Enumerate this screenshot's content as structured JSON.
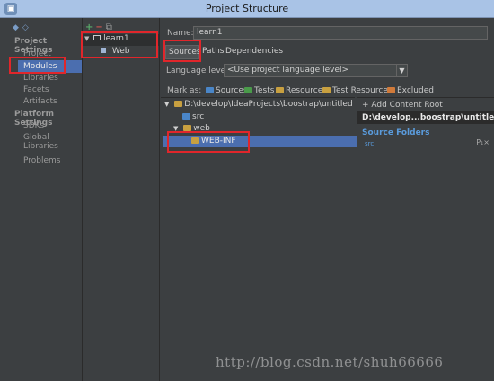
{
  "window": {
    "title": "Project Structure"
  },
  "nav": {
    "back": "◆",
    "forward": "◇",
    "project_settings_header": "Project Settings",
    "project_settings_items": [
      "Project",
      "Modules",
      "Libraries",
      "Facets",
      "Artifacts"
    ],
    "platform_settings_header": "Platform Settings",
    "platform_settings_items": [
      "SDKs",
      "Global Libraries"
    ],
    "problems": "Problems",
    "selected": "Modules"
  },
  "modules_tree": {
    "toolbar": {
      "add": "+",
      "remove": "−",
      "copy": "⧉"
    },
    "module": "learn1",
    "facet": "Web"
  },
  "module": {
    "name_label": "Name:",
    "name_value": "learn1",
    "tabs": [
      "Sources",
      "Paths",
      "Dependencies"
    ],
    "active_tab": "Sources",
    "language_level_label": "Language level:",
    "language_level_value": "<Use project language level>",
    "mark_as_label": "Mark as:",
    "mark_as_options": [
      {
        "label": "Sources",
        "color": "#4a86c8"
      },
      {
        "label": "Tests",
        "color": "#4a9a4a"
      },
      {
        "label": "Resources",
        "color": "#c8a040"
      },
      {
        "label": "Test Resources",
        "color": "#c8a040"
      },
      {
        "label": "Excluded",
        "color": "#d07a3a"
      }
    ]
  },
  "content_tree": {
    "root": "D:\\develop\\IdeaProjects\\boostrap\\untitled",
    "children": [
      "src",
      "web",
      "WEB-INF"
    ],
    "selected": "WEB-INF"
  },
  "content_root": {
    "add_label": "+ Add Content Root",
    "path": "D:\\develop...boostrap\\untitled",
    "source_folders_header": "Source Folders",
    "source_folder": "src",
    "entry_actions": "P₁×"
  },
  "watermark": "http://blog.csdn.net/shuh66666",
  "colors": {
    "selection": "#4b6eaf",
    "highlight_box": "#e0262b",
    "folder": "#c8a040"
  }
}
